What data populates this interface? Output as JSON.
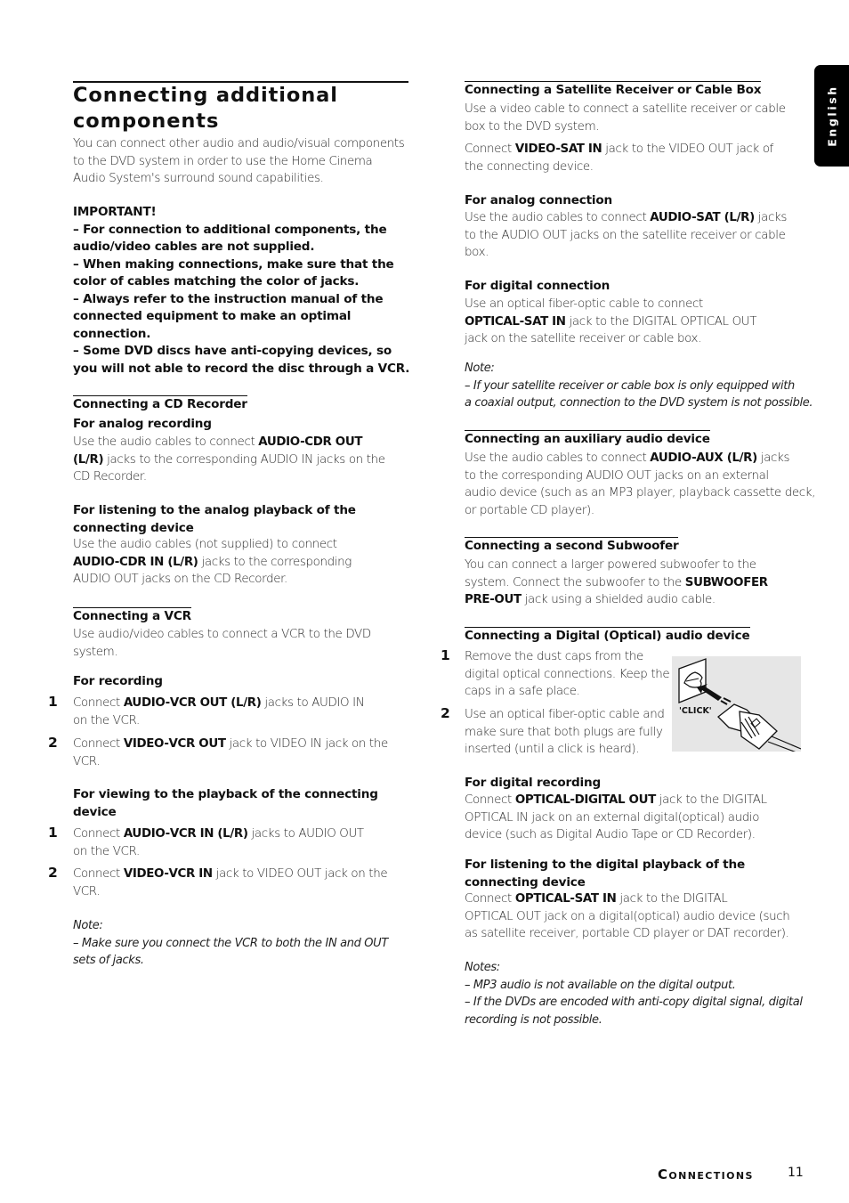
{
  "page": {
    "title_line1": "Connecting additional",
    "title_line2": "components",
    "intro": [
      "You can connect other audio and audio/visual components",
      "to the DVD system in order to use the Home Cinema",
      "Audio System's surround sound capabilities."
    ],
    "language_tab": "English",
    "footer_section": "Connections",
    "page_number": "11"
  },
  "important": {
    "label": "IMPORTANT!",
    "lines": [
      "–  For connection to additional components, the",
      "audio/video cables are not supplied.",
      "–  When making connections, make sure that the",
      "color of cables matching the color of jacks.",
      "–  Always refer to the instruction manual of the",
      "connected equipment to make an optimal",
      "connection.",
      "–  Some DVD discs have anti-copying devices, so",
      "you will not able to record the disc through a VCR."
    ]
  },
  "cd_recorder": {
    "heading": "Connecting a CD Recorder",
    "analog_heading": "For analog recording",
    "analog_l1_pre": "Use the audio cables to connect ",
    "analog_l1_kw1": "AUDIO-",
    "analog_l1_kw2": "CDR OUT",
    "analog_l2_kw": "(L/R)",
    "analog_l2_post": " jacks to the corresponding AUDIO IN jacks on the",
    "analog_l3": "CD Recorder.",
    "listen_heading_l1": "For listening to the analog playback of the",
    "listen_heading_l2": "connecting device",
    "listen_l1": "Use the audio cables (not supplied) to connect",
    "listen_l2_kw1": "AUDIO-",
    "listen_l2_kw2": "CDR IN (L/R)",
    "listen_l2_post": " jacks to the corresponding",
    "listen_l3": "AUDIO OUT jacks on the CD Recorder."
  },
  "vcr": {
    "heading": "Connecting a VCR",
    "intro_l1": "Use audio/video cables to connect a VCR to the DVD",
    "intro_l2": "system.",
    "recording_heading": "For recording",
    "rec_steps": [
      {
        "num": "1",
        "pre": "Connect ",
        "kw1": "AUDIO-",
        "kw2": "VCR OUT (L/R)",
        "post": " jacks to AUDIO IN",
        "l2": "on the VCR."
      },
      {
        "num": "2",
        "pre": "Connect ",
        "kw1": "VIDEO-",
        "kw2": "VCR OUT",
        "post": " jack to VIDEO IN jack on the",
        "l2": "VCR."
      }
    ],
    "viewing_heading_l1": "For viewing to the playback of the connecting",
    "viewing_heading_l2": "device",
    "view_steps": [
      {
        "num": "1",
        "pre": "Connect ",
        "kw1": "AUDIO-",
        "kw2": "VCR IN (L/R)",
        "post": " jacks to AUDIO OUT",
        "l2": "on the VCR."
      },
      {
        "num": "2",
        "pre": "Connect ",
        "kw1": "VIDEO-",
        "kw2": "VCR IN",
        "post": " jack to  VIDEO OUT jack on the",
        "l2": "VCR."
      }
    ],
    "note_label": "Note:",
    "note_l1": "–  Make sure you connect the VCR to both the IN and OUT",
    "note_l2": "sets of jacks."
  },
  "satellite": {
    "heading": "Connecting a Satellite Receiver or Cable Box",
    "intro_l1": "Use a video cable to connect a satellite receiver or cable",
    "intro_l2": "box to the DVD system.",
    "connect_pre": "Connect ",
    "connect_kw1": "VIDEO-",
    "connect_kw2": "SAT IN",
    "connect_post": " jack to the VIDEO OUT jack of",
    "connect_l2": "the connecting device.",
    "analog_heading": "For analog connection",
    "analog_l1_pre": "Use the audio cables to connect ",
    "analog_l1_kw1": "AUDIO-",
    "analog_l1_kw2": "SAT (L/R)",
    "analog_l1_post": " jacks",
    "analog_l2": "to the AUDIO OUT jacks on the satellite receiver or cable",
    "analog_l3": "box.",
    "digital_heading": "For digital connection",
    "digital_l1": "Use an optical fiber-optic cable to connect",
    "digital_l2_kw1": "OPTICAL-",
    "digital_l2_kw2": "SAT IN",
    "digital_l2_post": " jack to the DIGITAL OPTICAL OUT",
    "digital_l3": "jack on the satellite receiver or cable box.",
    "note_label": "Note:",
    "note_l1": "–  If your satellite receiver or cable box is only equipped with",
    "note_l2": "a coaxial output, connection to the DVD system is not possible."
  },
  "aux": {
    "heading": "Connecting an auxiliary audio device",
    "l1_pre": "Use the audio cables to connect ",
    "l1_kw1": "AUDIO-",
    "l1_kw2": "AUX (L/R)",
    "l1_post": " jacks",
    "l2": "to the corresponding AUDIO OUT jacks on an external",
    "l3": "audio device (such as an MP3 player, playback cassette deck,",
    "l4": "or portable CD player)."
  },
  "subwoofer": {
    "heading": "Connecting a second Subwoofer",
    "l1": "You can connect a larger powered subwoofer to the",
    "l2_pre": "system. Connect the subwoofer to the ",
    "l2_kw": "SUBWOOFER",
    "l3_kw": "PRE-OUT",
    "l3_post": " jack using a shielded audio cable."
  },
  "optical": {
    "heading": "Connecting a Digital (Optical) audio device",
    "steps": [
      {
        "num": "1",
        "lines": [
          "Remove the dust caps from the",
          "digital optical connections.  Keep the",
          "caps in a safe place."
        ]
      },
      {
        "num": "2",
        "lines": [
          "Use an optical fiber-optic cable and",
          "make sure that both plugs are fully",
          "inserted (until a click is heard)."
        ]
      }
    ],
    "figure_label": "'CLICK'",
    "rec_heading": "For digital recording",
    "rec_l1_pre": "Connect ",
    "rec_l1_kw1": "OPTICAL-",
    "rec_l1_kw2": "DIGITAL OUT",
    "rec_l1_post": " jack to the DIGITAL",
    "rec_l2": "OPTICAL IN jack on an external digital(optical) audio",
    "rec_l3": "device (such as Digital Audio Tape or CD Recorder).",
    "listen_heading_l1": "For listening to the digital playback of the",
    "listen_heading_l2": "connecting device",
    "listen_l1_pre": "Connect ",
    "listen_l1_kw1": "OPTICAL-",
    "listen_l1_kw2": "SAT IN",
    "listen_l1_post": " jack to the DIGITAL",
    "listen_l2": "OPTICAL OUT jack on a digital(optical) audio device (such",
    "listen_l3": "as satellite receiver, portable CD player or DAT recorder).",
    "notes_label": "Notes:",
    "notes_l1": "–  MP3 audio is not available on the digital output.",
    "notes_l2": "–  If the DVDs are encoded with anti-copy digital signal, digital",
    "notes_l3": "recording is not possible."
  }
}
